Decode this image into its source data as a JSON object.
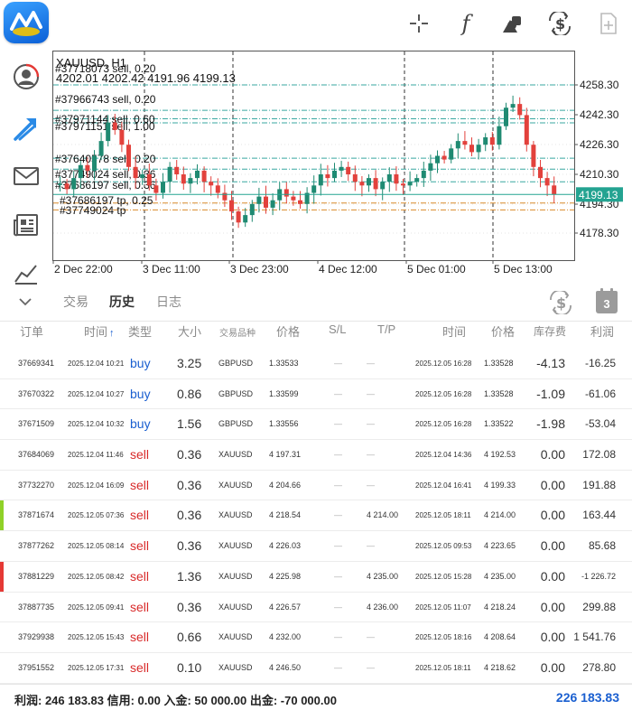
{
  "colors": {
    "buy": "#1a5fd0",
    "sell": "#d82a2a",
    "bull": "#1f8a72",
    "bear": "#e2413c",
    "price_tag": "#24a391",
    "marker_green": "#8fd128",
    "marker_red": "#e53935",
    "total": "#1a5fd0"
  },
  "toolbar": {
    "icons": [
      "crosshair-icon",
      "function-icon",
      "objects-icon",
      "trade-icon",
      "new-order-icon"
    ]
  },
  "sidebar": {
    "icons": [
      "account-icon",
      "trade-arrows-icon",
      "mail-icon",
      "news-icon",
      "chart-icon"
    ]
  },
  "chart": {
    "symbol_label": "XAUUSD, H1",
    "ohlc": "4202.01 4202.42 4191.96 4199.13",
    "price_tag": "4199.13",
    "y_ticks": [
      "4258.30",
      "4242.30",
      "4226.30",
      "4210.30",
      "4194.30",
      "4178.30"
    ],
    "x_ticks": [
      "2 Dec 22:00",
      "3 Dec 11:00",
      "3 Dec 23:00",
      "4 Dec 12:00",
      "5 Dec 01:00",
      "5 Dec 13:00"
    ],
    "order_labels": [
      "#37718073 sell, 0.20",
      "#37966743 sell, 0.20",
      "#37971144 sell, 0.60",
      "#37971151 sell, 1.00",
      "#37640578 sell, 0.20",
      "#37749024 sell, 0.36",
      "#37686197 sell, 0.36",
      "#37686197 tp, 0.25",
      "#37749024 tp"
    ]
  },
  "tabs": {
    "items": [
      "交易",
      "历史",
      "日志"
    ],
    "active": "历史",
    "calendar_badge": "3"
  },
  "table": {
    "headers": {
      "order": "订单",
      "time": "时间",
      "type": "类型",
      "volume": "大小",
      "symbol": "交易品种",
      "price": "价格",
      "sl": "S/L",
      "tp": "T/P",
      "close_time": "时间",
      "close_price": "价格",
      "swap": "库存费",
      "profit": "利润"
    },
    "sort_arrow": "↑",
    "rows": [
      {
        "order": "37669341",
        "time": "2025.12.04 10:21",
        "type": "buy",
        "volume": "3.25",
        "symbol": "GBPUSD",
        "price": "1.33533",
        "sl": "—",
        "tp": "—",
        "close_time": "2025.12.05 16:28",
        "close_price": "1.33528",
        "swap": "-4.13",
        "profit": "-16.25",
        "marker": ""
      },
      {
        "order": "37670322",
        "time": "2025.12.04 10:27",
        "type": "buy",
        "volume": "0.86",
        "symbol": "GBPUSD",
        "price": "1.33599",
        "sl": "—",
        "tp": "—",
        "close_time": "2025.12.05 16:28",
        "close_price": "1.33528",
        "swap": "-1.09",
        "profit": "-61.06",
        "marker": ""
      },
      {
        "order": "37671509",
        "time": "2025.12.04 10:32",
        "type": "buy",
        "volume": "1.56",
        "symbol": "GBPUSD",
        "price": "1.33556",
        "sl": "—",
        "tp": "—",
        "close_time": "2025.12.05 16:28",
        "close_price": "1.33522",
        "swap": "-1.98",
        "profit": "-53.04",
        "marker": ""
      },
      {
        "order": "37684069",
        "time": "2025.12.04 11:46",
        "type": "sell",
        "volume": "0.36",
        "symbol": "XAUUSD",
        "price": "4 197.31",
        "sl": "—",
        "tp": "—",
        "close_time": "2025.12.04 14:36",
        "close_price": "4 192.53",
        "swap": "0.00",
        "profit": "172.08",
        "marker": ""
      },
      {
        "order": "37732270",
        "time": "2025.12.04 16:09",
        "type": "sell",
        "volume": "0.36",
        "symbol": "XAUUSD",
        "price": "4 204.66",
        "sl": "—",
        "tp": "—",
        "close_time": "2025.12.04 16:41",
        "close_price": "4 199.33",
        "swap": "0.00",
        "profit": "191.88",
        "marker": ""
      },
      {
        "order": "37871674",
        "time": "2025.12.05 07:36",
        "type": "sell",
        "volume": "0.36",
        "symbol": "XAUUSD",
        "price": "4 218.54",
        "sl": "—",
        "tp": "4 214.00",
        "close_time": "2025.12.05 18:11",
        "close_price": "4 214.00",
        "swap": "0.00",
        "profit": "163.44",
        "marker": "green"
      },
      {
        "order": "37877262",
        "time": "2025.12.05 08:14",
        "type": "sell",
        "volume": "0.36",
        "symbol": "XAUUSD",
        "price": "4 226.03",
        "sl": "—",
        "tp": "—",
        "close_time": "2025.12.05 09:53",
        "close_price": "4 223.65",
        "swap": "0.00",
        "profit": "85.68",
        "marker": ""
      },
      {
        "order": "37881229",
        "time": "2025.12.05 08:42",
        "type": "sell",
        "volume": "1.36",
        "symbol": "XAUUSD",
        "price": "4 225.98",
        "sl": "—",
        "tp": "4 235.00",
        "close_time": "2025.12.05 15:28",
        "close_price": "4 235.00",
        "swap": "0.00",
        "profit": "-1 226.72",
        "marker": "red"
      },
      {
        "order": "37887735",
        "time": "2025.12.05 09:41",
        "type": "sell",
        "volume": "0.36",
        "symbol": "XAUUSD",
        "price": "4 226.57",
        "sl": "—",
        "tp": "4 236.00",
        "close_time": "2025.12.05 11:07",
        "close_price": "4 218.24",
        "swap": "0.00",
        "profit": "299.88",
        "marker": ""
      },
      {
        "order": "37929938",
        "time": "2025.12.05 15:43",
        "type": "sell",
        "volume": "0.66",
        "symbol": "XAUUSD",
        "price": "4 232.00",
        "sl": "—",
        "tp": "—",
        "close_time": "2025.12.05 18:16",
        "close_price": "4 208.64",
        "swap": "0.00",
        "profit": "1 541.76",
        "marker": ""
      },
      {
        "order": "37951552",
        "time": "2025.12.05 17:31",
        "type": "sell",
        "volume": "0.10",
        "symbol": "XAUUSD",
        "price": "4 246.50",
        "sl": "—",
        "tp": "—",
        "close_time": "2025.12.05 18:11",
        "close_price": "4 218.62",
        "swap": "0.00",
        "profit": "278.80",
        "marker": ""
      }
    ]
  },
  "footer": {
    "summary": "利润: 246 183.83  信用: 0.00  入金: 50 000.00  出金: -70 000.00",
    "total": "226 183.83"
  }
}
